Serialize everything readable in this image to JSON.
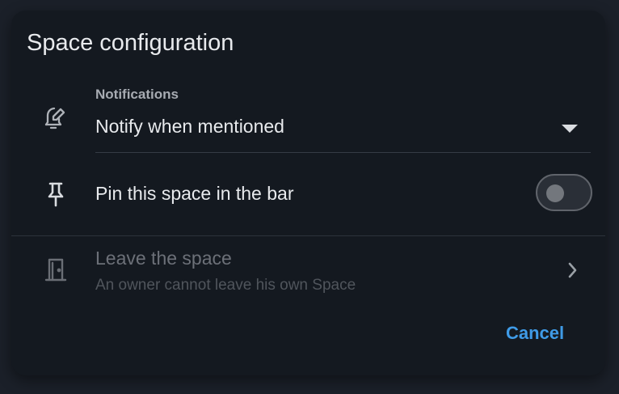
{
  "dialog": {
    "title": "Space configuration",
    "notifications": {
      "label": "Notifications",
      "value": "Notify when mentioned",
      "icon": "bell-edit-icon"
    },
    "pin": {
      "label": "Pin this space in the bar",
      "icon": "pin-icon",
      "enabled": false
    },
    "leave": {
      "label": "Leave the space",
      "subtitle": "An owner cannot leave his own Space",
      "icon": "door-icon",
      "disabled": true
    },
    "cancel_label": "Cancel"
  },
  "colors": {
    "accent": "#3f9be7",
    "dialog_background": "#141920",
    "page_background": "#1b2029"
  }
}
